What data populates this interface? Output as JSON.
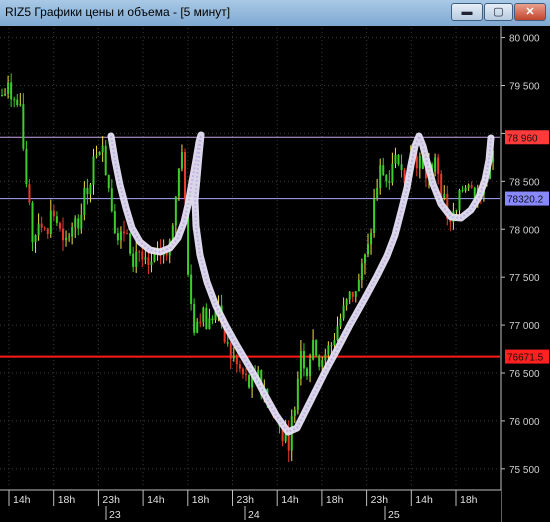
{
  "window": {
    "title": "RIZ5 Графики цены и объема - [5 минут]",
    "buttons": {
      "minimize": "▬",
      "maximize": "▢",
      "close": "✕"
    }
  },
  "chart_data": {
    "type": "candlestick",
    "title": "RIZ5 Графики цены и объема - [5 минут]",
    "ylim": [
      75300,
      80100
    ],
    "y_ticks": [
      "80 000",
      "79 500",
      "79 000",
      "78 500",
      "78 000",
      "77 500",
      "77 000",
      "76 500",
      "76 000",
      "75 500"
    ],
    "y_tick_values": [
      80000,
      79500,
      79000,
      78500,
      78000,
      77500,
      77000,
      76500,
      76000,
      75500
    ],
    "x_tick_labels": [
      "14h",
      "18h",
      "23h",
      "14h",
      "18h",
      "23h",
      "14h",
      "18h",
      "23h",
      "14h",
      "18h"
    ],
    "date_labels": [
      "23",
      "24",
      "25"
    ],
    "grid": true,
    "horizontal_levels": [
      {
        "value": 78960,
        "label": "78 960",
        "color": "#c9a6e6",
        "label_bg": "#ff3a3a",
        "label_color": "#111111"
      },
      {
        "value": 78320.2,
        "label": "78320.2",
        "color": "#a8a8ff",
        "label_bg": "#8888ff",
        "label_color": "#111111"
      },
      {
        "value": 76671.5,
        "label": "76671.5",
        "color": "#ff1a1a",
        "label_bg": "#ff2020",
        "label_color": "#111111"
      }
    ],
    "price_path": [
      [
        0,
        79400
      ],
      [
        1,
        79450
      ],
      [
        2,
        79350
      ],
      [
        3,
        79200
      ],
      [
        4,
        78400
      ],
      [
        5,
        77850
      ],
      [
        6,
        78150
      ],
      [
        7,
        77950
      ],
      [
        8,
        78200
      ],
      [
        9,
        78050
      ],
      [
        10,
        77750
      ],
      [
        11,
        78100
      ],
      [
        12,
        78050
      ],
      [
        13,
        78300
      ],
      [
        14,
        78500
      ],
      [
        15,
        78800
      ],
      [
        16,
        78950
      ],
      [
        17,
        78500
      ],
      [
        18,
        78100
      ],
      [
        19,
        77900
      ],
      [
        20,
        78050
      ],
      [
        21,
        77700
      ],
      [
        22,
        77800
      ],
      [
        23,
        77600
      ],
      [
        24,
        77650
      ],
      [
        25,
        77700
      ],
      [
        26,
        77800
      ],
      [
        27,
        77850
      ],
      [
        28,
        78400
      ],
      [
        29,
        78900
      ],
      [
        30,
        77450
      ],
      [
        31,
        76950
      ],
      [
        32,
        77150
      ],
      [
        33,
        77000
      ],
      [
        34,
        77050
      ],
      [
        35,
        77200
      ],
      [
        36,
        76850
      ],
      [
        37,
        76650
      ],
      [
        38,
        76550
      ],
      [
        39,
        76450
      ],
      [
        40,
        76350
      ],
      [
        41,
        76500
      ],
      [
        42,
        76250
      ],
      [
        43,
        76150
      ],
      [
        44,
        76050
      ],
      [
        45,
        75900
      ],
      [
        46,
        75750
      ],
      [
        47,
        76150
      ],
      [
        48,
        76800
      ],
      [
        49,
        76500
      ],
      [
        50,
        76850
      ],
      [
        51,
        76600
      ],
      [
        52,
        76700
      ],
      [
        53,
        76800
      ],
      [
        54,
        77000
      ],
      [
        55,
        77150
      ],
      [
        56,
        77300
      ],
      [
        57,
        77400
      ],
      [
        58,
        77600
      ],
      [
        59,
        77800
      ],
      [
        60,
        78350
      ],
      [
        61,
        78650
      ],
      [
        62,
        78500
      ],
      [
        63,
        78800
      ],
      [
        64,
        78550
      ],
      [
        65,
        78600
      ],
      [
        66,
        78850
      ],
      [
        67,
        78700
      ],
      [
        68,
        78550
      ],
      [
        69,
        78650
      ],
      [
        70,
        78700
      ],
      [
        71,
        78300
      ],
      [
        72,
        78050
      ],
      [
        73,
        78150
      ],
      [
        74,
        78400
      ],
      [
        75,
        78550
      ],
      [
        76,
        78350
      ],
      [
        77,
        78450
      ],
      [
        78,
        78600
      ],
      [
        79,
        78900
      ]
    ],
    "annotation_curve": [
      [
        111,
        136
      ],
      [
        115,
        160
      ],
      [
        120,
        185
      ],
      [
        126,
        208
      ],
      [
        132,
        228
      ],
      [
        140,
        242
      ],
      [
        150,
        250
      ],
      [
        160,
        252
      ],
      [
        170,
        248
      ],
      [
        178,
        238
      ],
      [
        184,
        222
      ],
      [
        188,
        205
      ],
      [
        192,
        182
      ],
      [
        196,
        160
      ],
      [
        199,
        142
      ],
      [
        201,
        135
      ],
      [
        199,
        155
      ],
      [
        197,
        178
      ],
      [
        195,
        200
      ],
      [
        196,
        226
      ],
      [
        200,
        255
      ],
      [
        207,
        282
      ],
      [
        216,
        306
      ],
      [
        226,
        326
      ],
      [
        236,
        344
      ],
      [
        246,
        361
      ],
      [
        256,
        378
      ],
      [
        266,
        397
      ],
      [
        276,
        415
      ],
      [
        288,
        432
      ],
      [
        297,
        428
      ],
      [
        306,
        410
      ],
      [
        316,
        390
      ],
      [
        326,
        370
      ],
      [
        338,
        348
      ],
      [
        350,
        325
      ],
      [
        364,
        300
      ],
      [
        377,
        276
      ],
      [
        387,
        256
      ],
      [
        395,
        235
      ],
      [
        401,
        212
      ],
      [
        407,
        188
      ],
      [
        411,
        165
      ],
      [
        415,
        146
      ],
      [
        419,
        136
      ],
      [
        423,
        146
      ],
      [
        427,
        162
      ],
      [
        433,
        184
      ],
      [
        441,
        204
      ],
      [
        451,
        217
      ],
      [
        461,
        218
      ],
      [
        471,
        210
      ],
      [
        479,
        197
      ],
      [
        485,
        180
      ],
      [
        489,
        160
      ],
      [
        491,
        138
      ]
    ]
  }
}
